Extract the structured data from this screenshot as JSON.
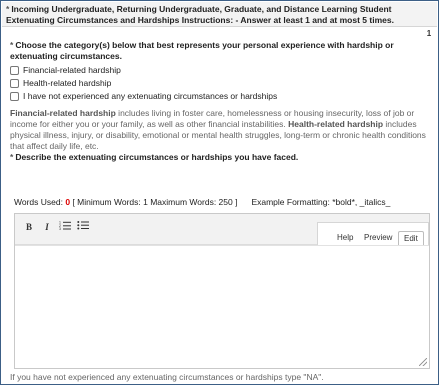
{
  "header": {
    "title": "Incoming Undergraduate, Returning Undergraduate, Graduate, and Distance Learning Student Extenuating Circumstances and Hardships Instructions: - Answer at least 1 and at most 5 times."
  },
  "page_badge": "1",
  "question1": {
    "label": "Choose the category(s) below that best represents your personal experience with hardship or extenuating circumstances.",
    "options": [
      {
        "label": "Financial-related hardship",
        "checked": false
      },
      {
        "label": "Health-related hardship",
        "checked": false
      },
      {
        "label": "I have not experienced any extenuating circumstances or hardships",
        "checked": false
      }
    ],
    "info": {
      "fin_term": "Financial-related hardship",
      "fin_text": " includes living in foster care, homelessness or housing insecurity, loss of job or income for either you or your family, as well as other financial instabilities. ",
      "health_term": "Health-related hardship",
      "health_text": " includes physical illness, injury, or disability, emotional or mental health struggles, long-term or chronic health conditions that affect daily life, etc."
    }
  },
  "question2": {
    "label": "Describe the extenuating circumstances or hardships you have faced."
  },
  "counter": {
    "prefix": "Words Used: ",
    "count": "0",
    "limits": " [ Minimum Words: 1 Maximum Words: 250 ]",
    "formatting": "Example Formatting: *bold*, _italics_"
  },
  "editor": {
    "bold_label": "B",
    "italic_label": "I",
    "ordered_list_label": "⅓",
    "bullet_list_label": "☰",
    "tabs": [
      "Help",
      "Preview",
      "Edit"
    ],
    "active_tab": "Edit",
    "value": ""
  },
  "help_text": "If you have not experienced any extenuating circumstances or hardships type \"NA\".",
  "colors": {
    "accent_border": "#3c5f86",
    "required_count": "#d00000"
  }
}
